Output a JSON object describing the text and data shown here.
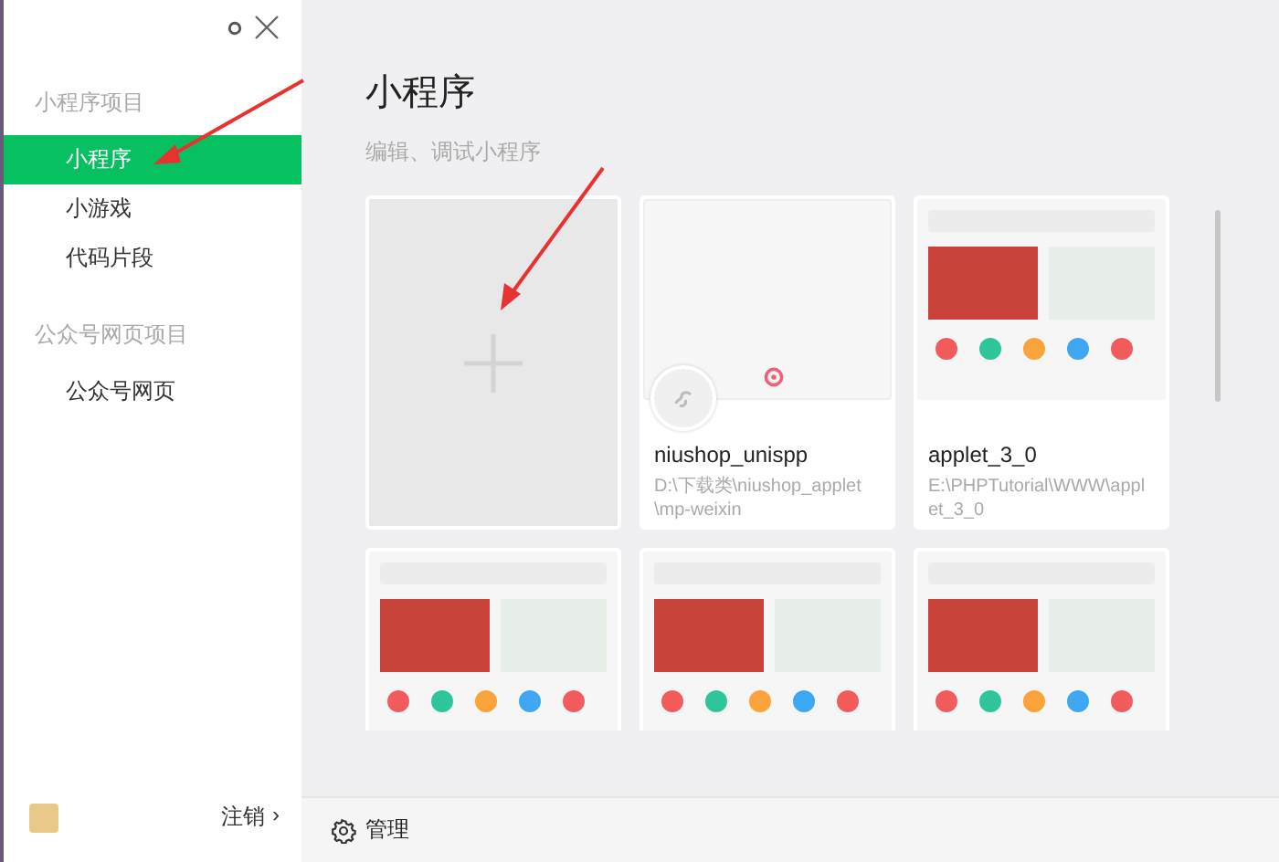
{
  "sidebar": {
    "sections": [
      {
        "title": "小程序项目",
        "items": [
          {
            "label": "小程序",
            "selected": true
          },
          {
            "label": "小游戏",
            "selected": false
          },
          {
            "label": "代码片段",
            "selected": false
          }
        ]
      },
      {
        "title": "公众号网页项目",
        "items": [
          {
            "label": "公众号网页",
            "selected": false
          }
        ]
      }
    ],
    "footer": {
      "logout": "注销",
      "chevron": "›"
    }
  },
  "main": {
    "title": "小程序",
    "subtitle": "编辑、调试小程序",
    "projects": [
      {
        "kind": "new"
      },
      {
        "kind": "blank",
        "name": "niushop_unispp",
        "path": "D:\\下载类\\niushop_applet\\mp-weixin"
      },
      {
        "kind": "screenshot",
        "name": "applet_3_0",
        "path": "E:\\PHPTutorial\\WWW\\applet_3_0"
      },
      {
        "kind": "screenshot"
      },
      {
        "kind": "screenshot"
      },
      {
        "kind": "screenshot"
      }
    ]
  },
  "toolbar": {
    "manage": "管理"
  }
}
